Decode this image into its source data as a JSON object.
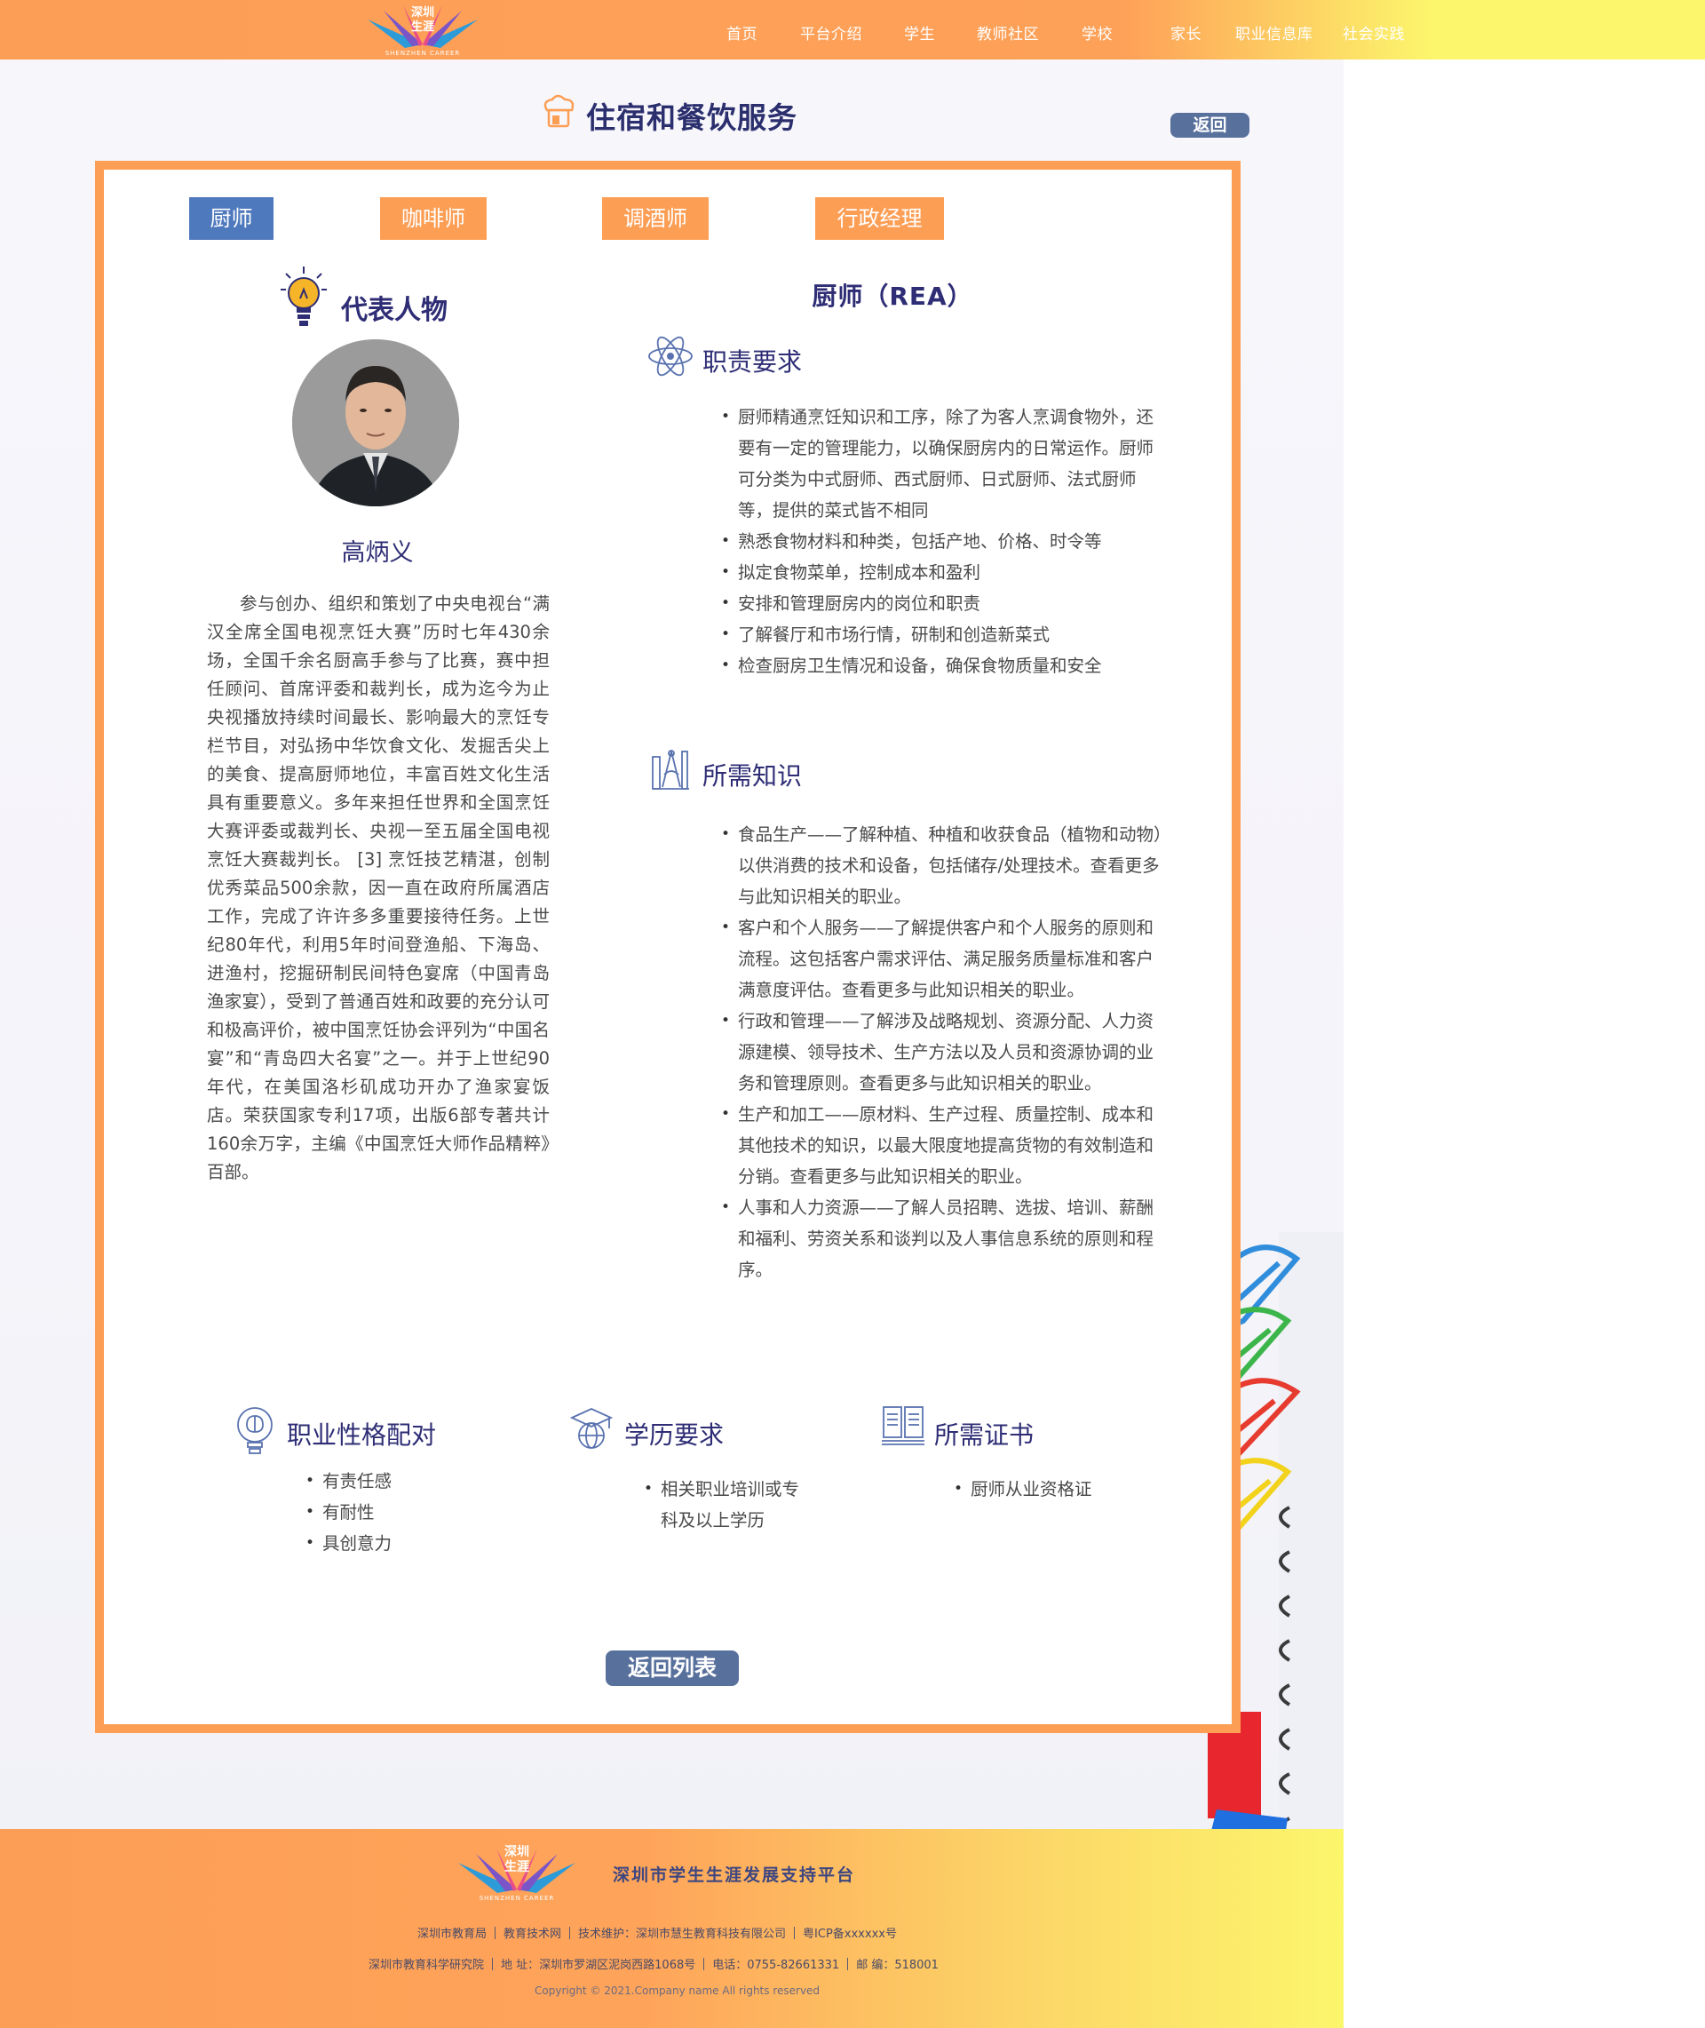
{
  "header": {
    "logo_text": "深圳生涯",
    "logo_sub": "SHENZHEN CAREER",
    "nav": [
      "首页",
      "平台介绍",
      "学生",
      "教师社区",
      "学校",
      "家长",
      "职业信息库",
      "社会实践"
    ]
  },
  "page": {
    "title": "住宿和餐饮服务",
    "back_label": "返回",
    "return_list_label": "返回列表"
  },
  "tabs": [
    {
      "label": "厨师",
      "active": true
    },
    {
      "label": "咖啡师",
      "active": false
    },
    {
      "label": "调酒师",
      "active": false
    },
    {
      "label": "行政经理",
      "active": false
    }
  ],
  "person": {
    "heading": "代表人物",
    "name": "高炳义",
    "bio": "参与创办、组织和策划了中央电视台“满汉全席全国电视烹饪大赛”历时七年430余场，全国千余名厨高手参与了比赛，赛中担任顾问、首席评委和裁判长，成为迄今为止央视播放持续时间最长、影响最大的烹饪专栏节目，对弘扬中华饮食文化、发掘舌尖上的美食、提高厨师地位，丰富百姓文化生活具有重要意义。多年来担任世界和全国烹饪大赛评委或裁判长、央视一至五届全国电视烹饪大赛裁判长。 [3]  烹饪技艺精湛，创制优秀菜品500余款，因一直在政府所属酒店工作，完成了许许多多重要接待任务。上世纪80年代，利用5年时间登渔船、下海岛、进渔村，挖掘研制民间特色宴席（中国青岛渔家宴），受到了普通百姓和政要的充分认可和极高评价，被中国烹饪协会评列为“中国名宴”和“青岛四大名宴”之一。并于上世纪90年代，在美国洛杉矶成功开办了渔家宴饭店。荣获国家专利17项，出版6部专著共计160余万字，主编《中国烹饪大师作品精粹》百部。"
  },
  "job": {
    "title": "厨师（REA）",
    "duties_heading": "职责要求",
    "duties": [
      "厨师精通烹饪知识和工序，除了为客人烹调食物外，还要有一定的管理能力，以确保厨房内的日常运作。厨师可分类为中式厨师、西式厨师、日式厨师、法式厨师等，提供的菜式皆不相同",
      "熟悉食物材料和种类，包括产地、价格、时令等",
      "拟定食物菜单，控制成本和盈利",
      "安排和管理厨房内的岗位和职责",
      "了解餐厅和市场行情，研制和创造新菜式",
      "检查厨房卫生情况和设备，确保食物质量和安全"
    ],
    "knowledge_heading": "所需知识",
    "knowledge": [
      "食品生产——了解种植、种植和收获食品（植物和动物）以供消费的技术和设备，包括储存/处理技术。查看更多与此知识相关的职业。",
      "客户和个人服务——了解提供客户和个人服务的原则和流程。这包括客户需求评估、满足服务质量标准和客户满意度评估。查看更多与此知识相关的职业。",
      "行政和管理——了解涉及战略规划、资源分配、人力资源建模、领导技术、生产方法以及人员和资源协调的业务和管理原则。查看更多与此知识相关的职业。",
      "生产和加工——原材料、生产过程、质量控制、成本和其他技术的知识，以最大限度地提高货物的有效制造和分销。查看更多与此知识相关的职业。",
      "人事和人力资源——了解人员招聘、选拔、培训、薪酬和福利、劳资关系和谈判以及人事信息系统的原则和程序。"
    ],
    "personality_heading": "职业性格配对",
    "personality": [
      "有责任感",
      "有耐性",
      "具创意力"
    ],
    "education_heading": "学历要求",
    "education": [
      "相关职业培训或专科及以上学历"
    ],
    "cert_heading": "所需证书",
    "certs": [
      "厨师从业资格证"
    ]
  },
  "footer": {
    "platform_name": "深圳市学生生涯发展支持平台",
    "row1": [
      "深圳市教育局",
      "教育技术网",
      "技术维护：深圳市慧生教育科技有限公司",
      "粤ICP备xxxxxx号"
    ],
    "row2": [
      "深圳市教育科学研究院",
      "地  址：深圳市罗湖区泥岗西路1068号",
      "电话：0755-82661331",
      "邮  编：518001"
    ],
    "copyright": "Copyright © 2021.Company name All rights reserved"
  },
  "colors": {
    "orange": "#fd9e55",
    "navy_text": "#2e2d75",
    "tab_active": "#4f79bd",
    "button": "#58709c",
    "yellow": "#fcf66c"
  }
}
